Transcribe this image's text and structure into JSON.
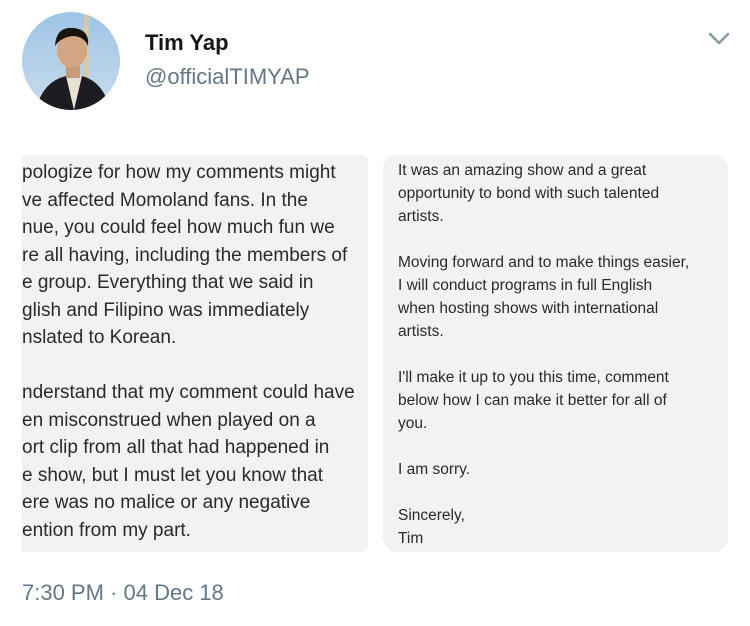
{
  "author": {
    "name": "Tim Yap",
    "handle": "@officialTIMYAP"
  },
  "icons": {
    "menu": "chevron-down-icon"
  },
  "colors": {
    "secondary_text": "#657786",
    "note_background": "#f2f2f2"
  },
  "note_left": {
    "lines": [
      "pologize for how my comments might",
      "ve affected Momoland fans. In the",
      "nue, you could feel how much fun we",
      "re all having, including the members of",
      "e group. Everything that we said in",
      "glish and Filipino was immediately",
      "nslated to Korean.",
      "",
      "nderstand that my comment could have",
      "en misconstrued when played on a",
      "ort clip from all that had happened in",
      "e show, but I must let you know that",
      "ere was no malice or any negative",
      "ention from my part."
    ]
  },
  "note_right": {
    "lines": [
      "It was an amazing show and a great",
      "opportunity to bond with such talented",
      "artists.",
      "",
      "Moving forward and to make things easier,",
      "I will conduct programs in full English",
      "when hosting shows with international",
      "artists.",
      "",
      "I'll make it up to you this time, comment",
      "below how I can make it better for all of",
      "you.",
      "",
      "I am sorry.",
      "",
      "Sincerely,",
      "Tim"
    ]
  },
  "timestamp": "7:30 PM · 04 Dec 18"
}
